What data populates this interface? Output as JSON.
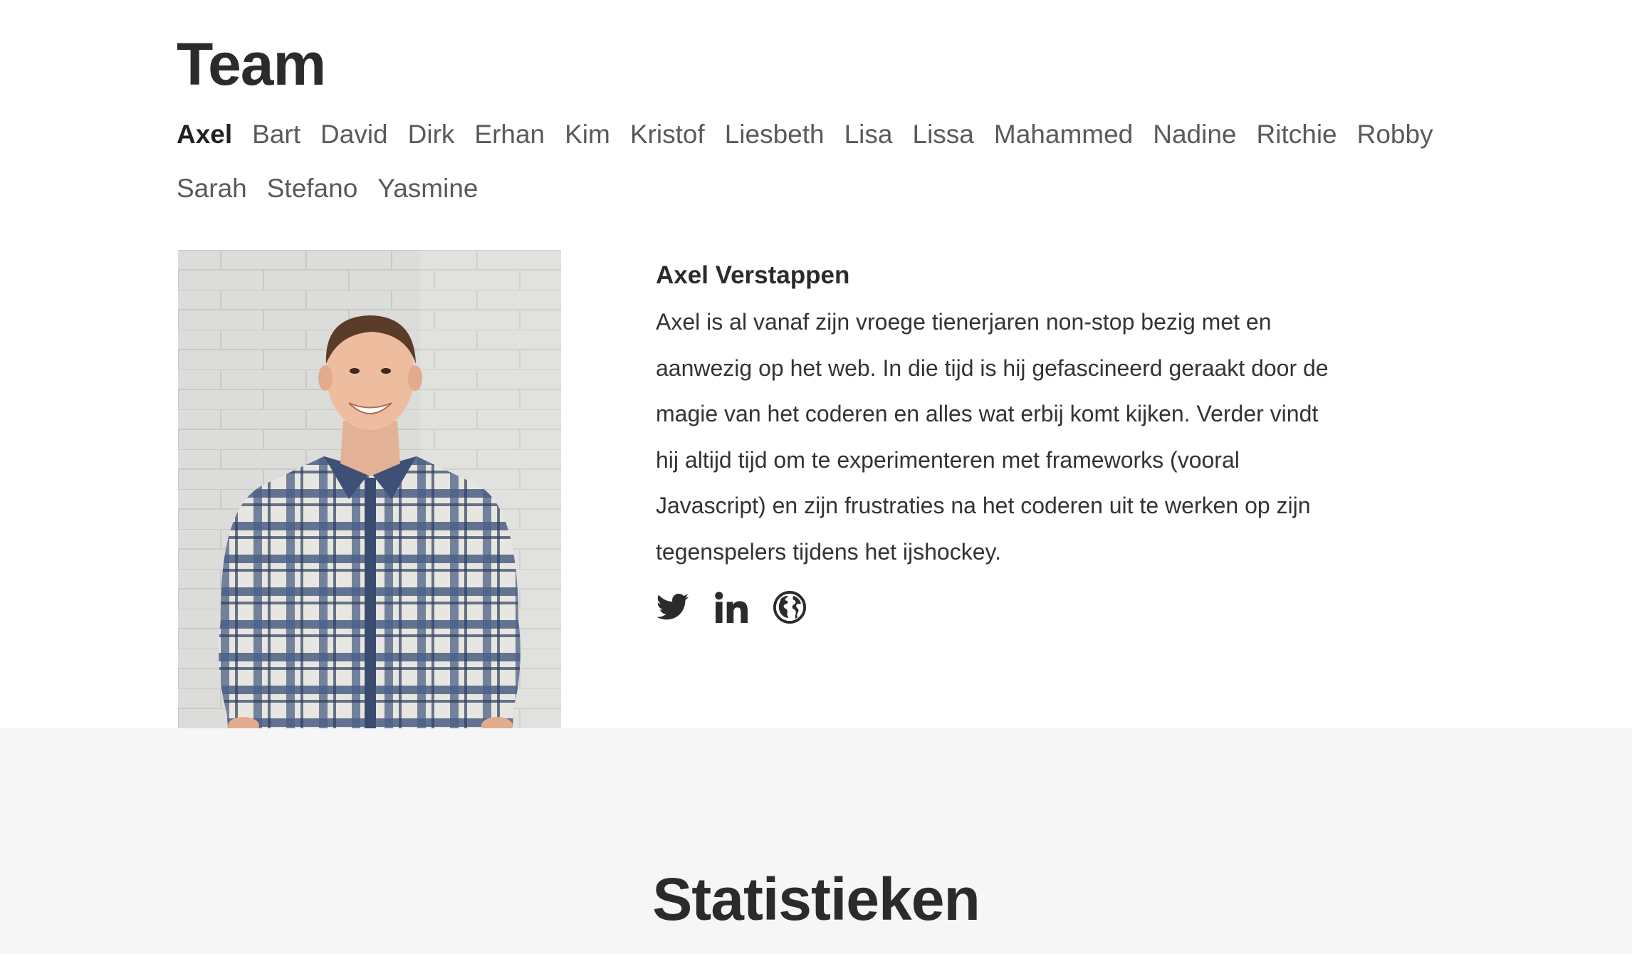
{
  "team": {
    "title": "Team",
    "members": [
      {
        "label": "Axel",
        "active": true
      },
      {
        "label": "Bart"
      },
      {
        "label": "David"
      },
      {
        "label": "Dirk"
      },
      {
        "label": "Erhan"
      },
      {
        "label": "Kim"
      },
      {
        "label": "Kristof"
      },
      {
        "label": "Liesbeth"
      },
      {
        "label": "Lisa"
      },
      {
        "label": "Lissa"
      },
      {
        "label": "Mahammed"
      },
      {
        "label": "Nadine"
      },
      {
        "label": "Ritchie"
      },
      {
        "label": "Robby"
      },
      {
        "label": "Sarah"
      },
      {
        "label": "Stefano"
      },
      {
        "label": "Yasmine"
      }
    ],
    "profile": {
      "name": "Axel Verstappen",
      "bio": "Axel is al vanaf zijn vroege tienerjaren non-stop bezig met en aanwezig op het web. In die tijd is hij gefascineerd geraakt door de magie van het coderen en alles wat erbij komt kijken. Verder vindt hij altijd tijd om te experimenteren met frameworks (vooral Javascript) en zijn frustraties na het coderen uit te werken op zijn tegenspelers tijdens het ijshockey.",
      "socials": [
        {
          "icon": "twitter-icon"
        },
        {
          "icon": "linkedin-icon"
        },
        {
          "icon": "globe-icon"
        }
      ]
    }
  },
  "stats": {
    "title": "Statistieken"
  },
  "colors": {
    "text": "#2b2b2b",
    "nav_inactive": "#5a5a5a",
    "stats_background": "#f6f6f6"
  }
}
